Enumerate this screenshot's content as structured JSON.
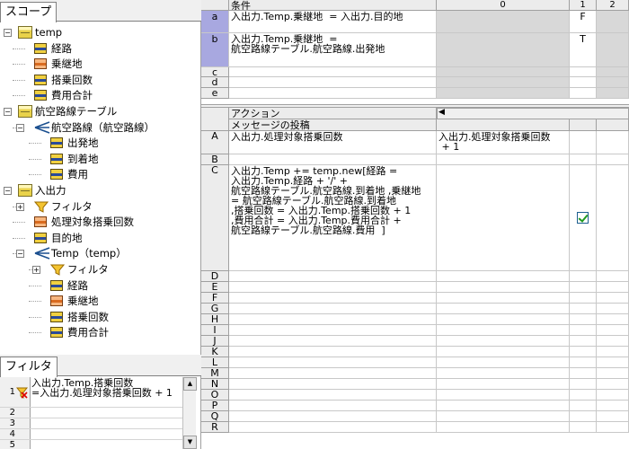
{
  "scope_tab": "スコープ",
  "filter_tab": "フィルタ",
  "tree": [
    {
      "label": "temp",
      "icon": "table-icon",
      "exp": "−"
    },
    {
      "label": "経路",
      "icon": "field-icon"
    },
    {
      "label": "乗継地",
      "icon": "field-orange-icon"
    },
    {
      "label": "搭乗回数",
      "icon": "field-icon"
    },
    {
      "label": "費用合計",
      "icon": "field-icon"
    },
    {
      "label": "航空路線テーブル",
      "icon": "table-icon",
      "exp": "−"
    },
    {
      "label": "航空路線（航空路線）",
      "icon": "join-icon",
      "exp": "−"
    },
    {
      "label": "出発地",
      "icon": "field-icon"
    },
    {
      "label": "到着地",
      "icon": "field-icon"
    },
    {
      "label": "費用",
      "icon": "field-icon"
    },
    {
      "label": "入出力",
      "icon": "table-icon",
      "exp": "−"
    },
    {
      "label": "フィルタ",
      "icon": "filter-icon",
      "exp": "+"
    },
    {
      "label": "処理対象搭乗回数",
      "icon": "field-orange-icon"
    },
    {
      "label": "目的地",
      "icon": "field-icon"
    },
    {
      "label": "Temp（temp）",
      "icon": "join-icon",
      "exp": "−"
    },
    {
      "label": "フィルタ",
      "icon": "filter-icon",
      "exp": "+"
    },
    {
      "label": "経路",
      "icon": "field-icon"
    },
    {
      "label": "乗継地",
      "icon": "field-orange-icon"
    },
    {
      "label": "搭乗回数",
      "icon": "field-icon"
    },
    {
      "label": "費用合計",
      "icon": "field-icon"
    }
  ],
  "filters": [
    {
      "num": "1",
      "text": "入出力.Temp.搭乗回数\n=入出力.処理対象搭乗回数 + 1"
    },
    {
      "num": "2",
      "text": ""
    },
    {
      "num": "3",
      "text": ""
    },
    {
      "num": "4",
      "text": ""
    },
    {
      "num": "5",
      "text": ""
    }
  ],
  "conditions": {
    "header": "条件",
    "col0": "0",
    "col1": "1",
    "col2": "2",
    "rows": [
      {
        "id": "a",
        "text": "入出力.Temp.乗継地  = 入出力.目的地",
        "v1": "F"
      },
      {
        "id": "b",
        "text": "入出力.Temp.乗継地  =\n航空路線テーブル.航空路線.出発地",
        "v1": "T"
      },
      {
        "id": "c",
        "text": "",
        "v1": ""
      },
      {
        "id": "d",
        "text": "",
        "v1": ""
      },
      {
        "id": "e",
        "text": "",
        "v1": ""
      }
    ]
  },
  "actions": {
    "header": "アクション",
    "subheader": "メッセージの投稿",
    "rows": [
      {
        "id": "A",
        "text": "入出力.処理対象搭乗回数",
        "v0": "入出力.処理対象搭乗回数\n + 1"
      },
      {
        "id": "B",
        "text": "",
        "v0": ""
      },
      {
        "id": "C",
        "text": "入出力.Temp += temp.new[経路 =\n入出力.Temp.経路 + '/' +\n航空路線テーブル.航空路線.到着地 ,乗継地\n= 航空路線テーブル.航空路線.到着地\n,搭乗回数 = 入出力.Temp.搭乗回数 + 1\n,費用合計 = 入出力.Temp.費用合計 +\n航空路線テーブル.航空路線.費用  ]",
        "v0": "",
        "check": true
      },
      {
        "id": "D",
        "text": ""
      },
      {
        "id": "E",
        "text": ""
      },
      {
        "id": "F",
        "text": ""
      },
      {
        "id": "G",
        "text": ""
      },
      {
        "id": "H",
        "text": ""
      },
      {
        "id": "I",
        "text": ""
      },
      {
        "id": "J",
        "text": ""
      },
      {
        "id": "K",
        "text": ""
      },
      {
        "id": "L",
        "text": ""
      },
      {
        "id": "M",
        "text": ""
      },
      {
        "id": "N",
        "text": ""
      },
      {
        "id": "O",
        "text": ""
      },
      {
        "id": "P",
        "text": ""
      },
      {
        "id": "Q",
        "text": ""
      },
      {
        "id": "R",
        "text": ""
      }
    ]
  }
}
